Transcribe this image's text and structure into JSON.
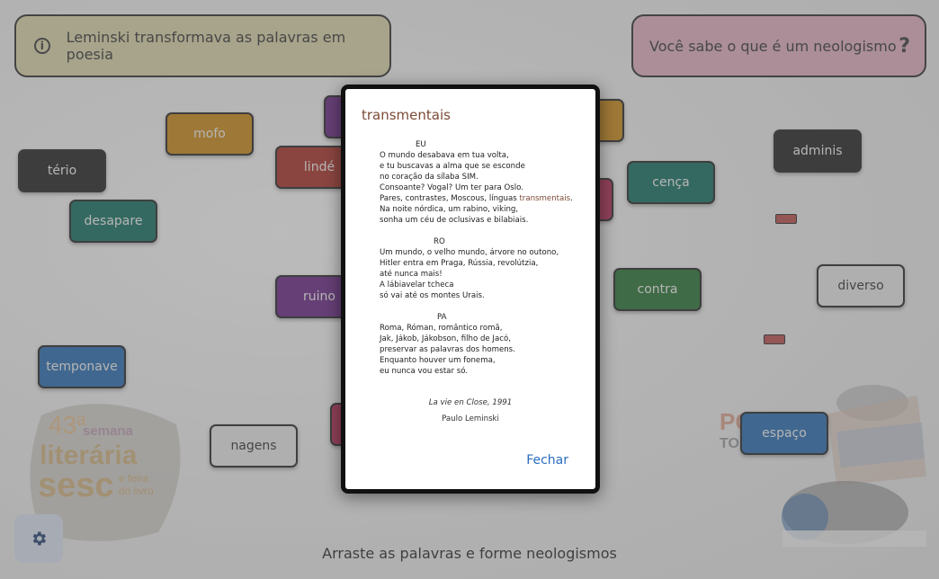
{
  "header": {
    "left_banner": "Leminski transformava as palavras em poesia",
    "right_banner": "Você sabe o que é um neologismo"
  },
  "words": [
    {
      "label": "mofo",
      "color": "#c2800f"
    },
    {
      "label": "tério",
      "color": "#1a1a1a"
    },
    {
      "label": "lindé",
      "color": "#a0291f"
    },
    {
      "label": "desapare",
      "color": "#0c6658"
    },
    {
      "label": "cença",
      "color": "#0c6658"
    },
    {
      "label": "adminis",
      "color": "#1a1a1a"
    },
    {
      "label": "ruino",
      "color": "#5f1e7a"
    },
    {
      "label": "contra",
      "color": "#1e6a2a"
    },
    {
      "label": "diverso",
      "color": "#dedede"
    },
    {
      "label": "temponave",
      "color": "#1f62a8"
    },
    {
      "label": "nagens",
      "color": "#dedede"
    },
    {
      "label": "espaço",
      "color": "#1f62a8"
    }
  ],
  "modal": {
    "title": "transmentais",
    "stanzas": [
      {
        "title": "EU",
        "lines": [
          "O mundo desabava em tua volta,",
          "e tu buscavas a alma que se esconde",
          "no coração da sílaba SIM.",
          "Consoante? Vogal? Um ter para Oslo.",
          "Pares, contrastes, Moscous, línguas ",
          "Na noite nórdica, um rabino, viking,",
          "sonha um céu de oclusivas e bilabiais."
        ]
      },
      {
        "title": "RO",
        "lines": [
          "Um mundo, o velho mundo, árvore no outono,",
          "Hitler entra em Praga, Rússia, revolútzia,",
          "até nunca mais!",
          "A lábiavelar tcheca",
          "só vai até os montes Urais."
        ]
      },
      {
        "title": "PA",
        "lines": [
          "Roma, Róman, romântico romã,",
          "Jak, Jákob, Jákobson, filho de Jacó,",
          "preservar as palavras dos homens.",
          "Enquanto houver um fonema,",
          "eu nunca vou estar só."
        ]
      }
    ],
    "highlight_word": "transmentais",
    "source": "La vie en Close, 1991",
    "author": "Paulo Leminski",
    "close_label": "Fechar"
  },
  "footer": {
    "instruction": "Arraste as palavras e forme neologismos"
  },
  "logos": {
    "event_number": "43ª",
    "event_line1": "semana",
    "event_line2": "literária",
    "event_line3": "sesc",
    "event_line4": "e feira",
    "event_line5": "do livro",
    "right_text1": "PO",
    "right_text2": "TO"
  },
  "icons": {
    "info": "info-icon",
    "question": "question-icon",
    "settings": "gear-icon"
  }
}
